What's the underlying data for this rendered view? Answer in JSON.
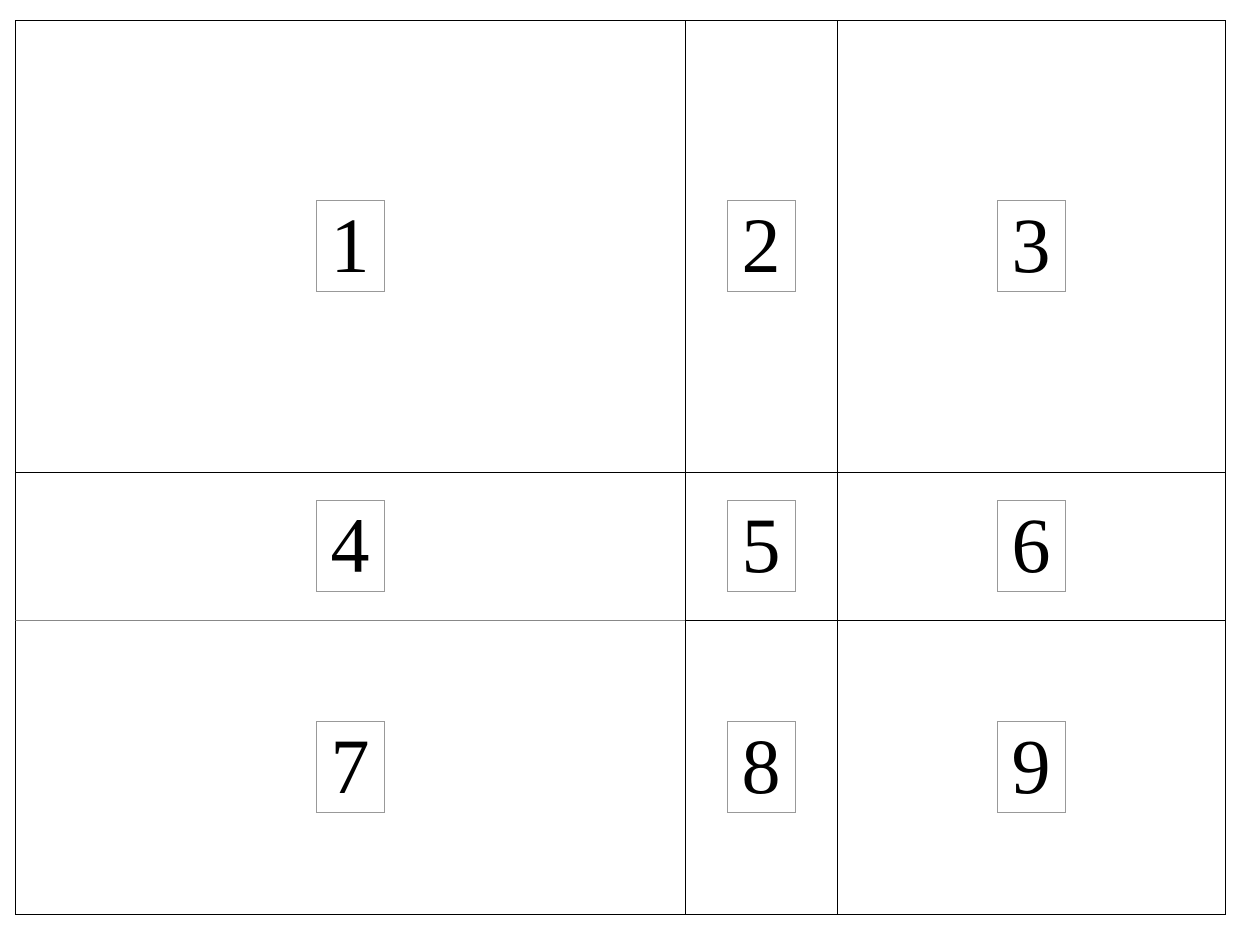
{
  "grid": {
    "cells": [
      {
        "label": "1"
      },
      {
        "label": "2"
      },
      {
        "label": "3"
      },
      {
        "label": "4"
      },
      {
        "label": "5"
      },
      {
        "label": "6"
      },
      {
        "label": "7"
      },
      {
        "label": "8"
      },
      {
        "label": "9"
      }
    ]
  }
}
